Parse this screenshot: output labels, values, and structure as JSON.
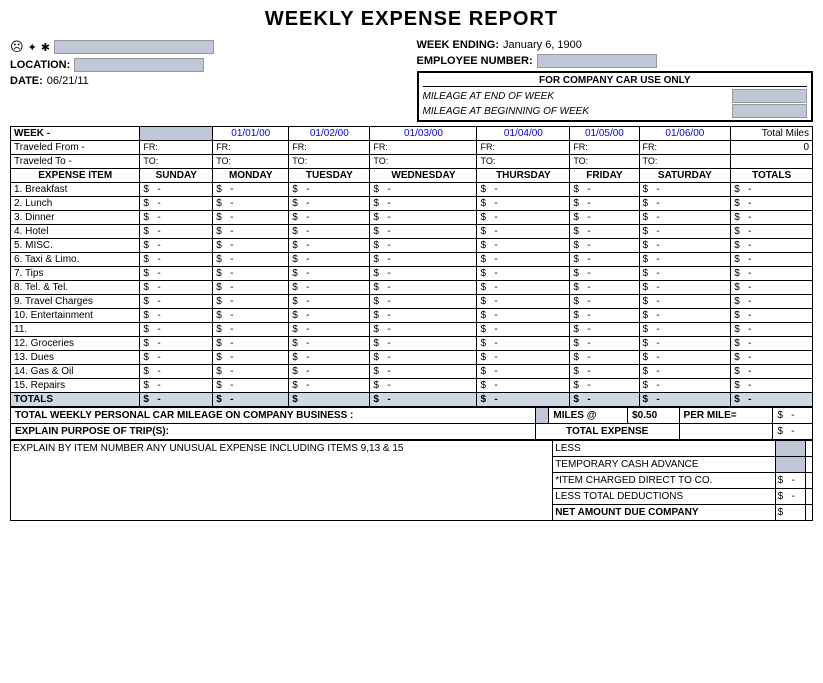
{
  "title": "WEEKLY EXPENSE REPORT",
  "header": {
    "week_ending_label": "WEEK ENDING:",
    "week_ending_value": "January 6, 1900",
    "employee_number_label": "EMPLOYEE NUMBER:",
    "location_label": "LOCATION:",
    "date_label": "DATE:",
    "date_value": "06/21/11"
  },
  "company_car": {
    "title": "FOR COMPANY CAR USE ONLY",
    "mileage_end_label": "MILEAGE AT END OF WEEK",
    "mileage_begin_label": "MILEAGE AT BEGINNING OF WEEK"
  },
  "week_row": {
    "label": "WEEK -",
    "dates": [
      "01/01/00",
      "01/02/00",
      "01/03/00",
      "01/04/00",
      "01/05/00",
      "01/06/00"
    ],
    "total_miles_label": "Total Miles"
  },
  "traveled_from": {
    "label": "Traveled From -",
    "fr_label": "FR:"
  },
  "traveled_to": {
    "label": "Traveled To -",
    "to_label": "TO:"
  },
  "table_headers": {
    "expense_item": "EXPENSE ITEM",
    "sunday": "SUNDAY",
    "monday": "MONDAY",
    "tuesday": "TUESDAY",
    "wednesday": "WEDNESDAY",
    "thursday": "THURSDAY",
    "friday": "FRIDAY",
    "saturday": "SATURDAY",
    "totals": "TOTALS"
  },
  "expense_items": [
    "1. Breakfast",
    "2. Lunch",
    "3. Dinner",
    "4. Hotel",
    "5. MISC.",
    "6. Taxi & Limo.",
    "7. Tips",
    "8. Tel. & Tel.",
    "9. Travel Charges",
    "10. Entertainment",
    "11.",
    "12. Groceries",
    "13. Dues",
    "14. Gas & Oil",
    "15. Repairs"
  ],
  "totals_label": "TOTALS",
  "mileage_section": {
    "label": "TOTAL WEEKLY PERSONAL CAR MILEAGE ON COMPANY BUSINESS :",
    "miles_at": "MILES @",
    "rate": "$0.50",
    "per_mile": "PER MILE=",
    "explain_label": "EXPLAIN PURPOSE OF TRIP(S):",
    "total_expense_label": "TOTAL EXPENSE"
  },
  "summary": {
    "less_label": "LESS",
    "temp_cash_label": "TEMPORARY CASH ADVANCE",
    "item_charged_label": "*ITEM CHARGED DIRECT TO CO.",
    "less_total_label": "LESS TOTAL DEDUCTIONS",
    "net_amount_label": "NET AMOUNT DUE COMPANY",
    "explain_items_label": "EXPLAIN BY ITEM NUMBER ANY UNUSUAL EXPENSE INCLUDING ITEMS 9,13 & 15"
  },
  "dollar_sign": "$",
  "dash": "-"
}
